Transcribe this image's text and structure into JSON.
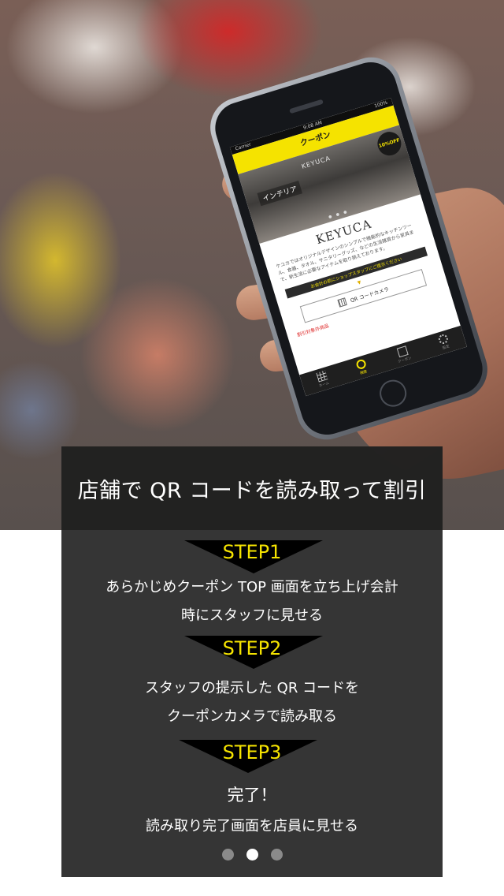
{
  "headline": "店舗で QR コードを読み取って割引",
  "steps": [
    {
      "label": "STEP1",
      "lines": [
        "あらかじめクーポン TOP 画面を立ち上げ会計",
        "時にスタッフに見せる"
      ]
    },
    {
      "label": "STEP2",
      "lines": [
        "スタッフの提示した QR コードを",
        "クーポンカメラで読み取る"
      ]
    },
    {
      "label": "STEP3",
      "lines": [
        "完了！",
        "読み取り完了画面を店員に見せる"
      ]
    }
  ],
  "pager": {
    "count": 3,
    "active_index": 1
  },
  "phone": {
    "status": {
      "carrier": "Carrier",
      "time": "9:08 AM",
      "battery": "100%"
    },
    "header_title": "クーポン",
    "photo_sign": "KEYUCA",
    "photo_category": "インテリア",
    "off_badge": "10%OFF",
    "logo": "KEYUCA",
    "description": "ケユカではオリジナルデザインのシンプルで機能的なキッチンツール、食器、タオル、サニタリーグッズ、などの生活雑貨から家具まで、新生活に必要なアイテムを取り揃えております。",
    "notice": "お会計の前にショップスタッフにご提示ください",
    "qr_button": "QR コードカメラ",
    "target_title": "割引対象外商品",
    "tabs": [
      {
        "label": "ホーム",
        "icon": "grid-icon"
      },
      {
        "label": "検索",
        "icon": "search-icon"
      },
      {
        "label": "クーポン",
        "icon": "list-icon"
      },
      {
        "label": "設定",
        "icon": "gear-icon"
      }
    ]
  },
  "colors": {
    "accent_yellow": "#f5e300",
    "panel": "#282828"
  }
}
